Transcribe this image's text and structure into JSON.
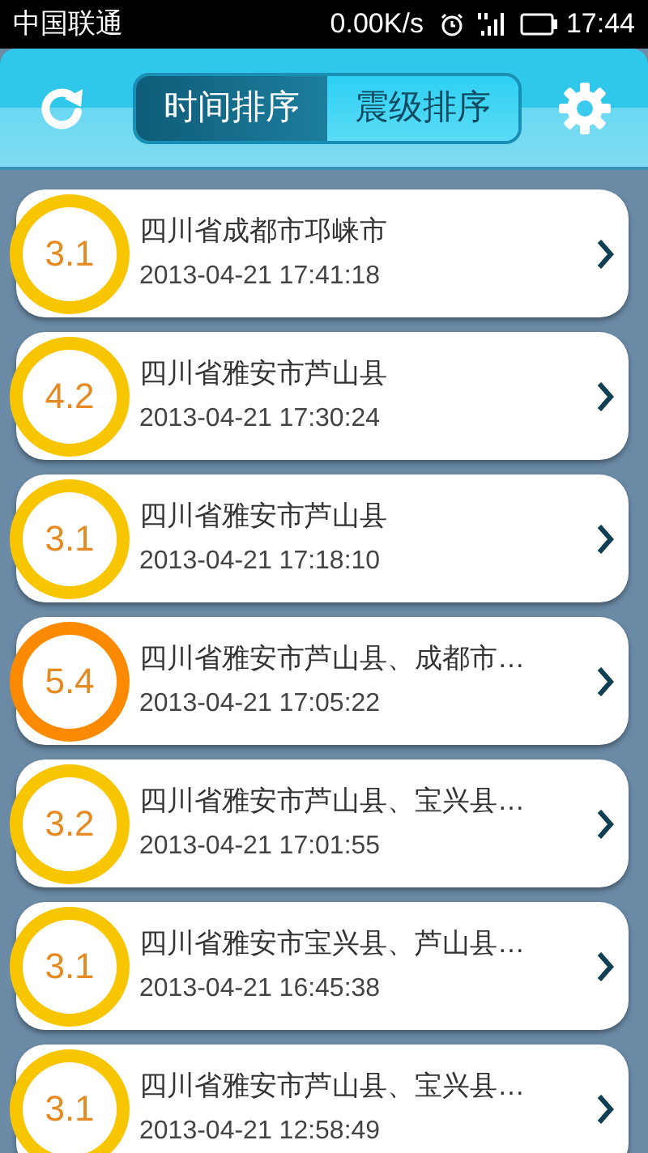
{
  "status_bar": {
    "carrier": "中国联通",
    "speed": "0.00K/s",
    "time": "17:44"
  },
  "tabs": [
    {
      "label": "时间排序",
      "selected": true
    },
    {
      "label": "震级排序",
      "selected": false
    }
  ],
  "quakes": [
    {
      "magnitude": "3.1",
      "place": "四川省成都市邛崃市",
      "time": "2013-04-21 17:41:18",
      "color": "#f7c600"
    },
    {
      "magnitude": "4.2",
      "place": "四川省雅安市芦山县",
      "time": "2013-04-21 17:30:24",
      "color": "#f7c600"
    },
    {
      "magnitude": "3.1",
      "place": "四川省雅安市芦山县",
      "time": "2013-04-21 17:18:10",
      "color": "#f7c600"
    },
    {
      "magnitude": "5.4",
      "place": "四川省雅安市芦山县、成都市…",
      "time": "2013-04-21 17:05:22",
      "color": "#fb8a00"
    },
    {
      "magnitude": "3.2",
      "place": "四川省雅安市芦山县、宝兴县…",
      "time": "2013-04-21 17:01:55",
      "color": "#f7c600"
    },
    {
      "magnitude": "3.1",
      "place": "四川省雅安市宝兴县、芦山县…",
      "time": "2013-04-21 16:45:38",
      "color": "#f7c600"
    },
    {
      "magnitude": "3.1",
      "place": "四川省雅安市芦山县、宝兴县…",
      "time": "2013-04-21 12:58:49",
      "color": "#f7c600"
    }
  ]
}
